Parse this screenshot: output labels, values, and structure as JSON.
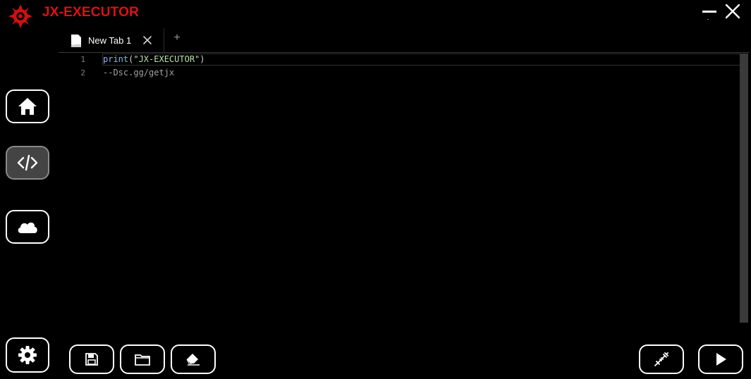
{
  "app": {
    "title": "JX-EXECUTOR",
    "brand_color": "#e01010",
    "logo_icon": "sharingan-logo-icon"
  },
  "window_controls": {
    "minimize_icon": "minimize-icon",
    "close_icon": "close-icon"
  },
  "tabs": [
    {
      "label": "New Tab 1",
      "icon": "document-icon",
      "close_icon": "close-icon"
    }
  ],
  "add_tab_label": "+",
  "editor": {
    "lines": [
      {
        "number": "1",
        "fn": "print",
        "open": "(",
        "str": "\"JX-EXECUTOR\"",
        "close": ")"
      },
      {
        "number": "2",
        "comment": "--Dsc.gg/getjx"
      }
    ]
  },
  "sidebar": {
    "items": [
      {
        "name": "home",
        "icon": "home-icon",
        "active": false
      },
      {
        "name": "editor",
        "icon": "code-icon",
        "active": true
      },
      {
        "name": "cloud",
        "icon": "cloud-icon",
        "active": false
      },
      {
        "name": "settings",
        "icon": "gear-icon",
        "active": false
      }
    ]
  },
  "toolbar": {
    "left": [
      {
        "name": "save",
        "icon": "save-icon"
      },
      {
        "name": "open",
        "icon": "folder-icon"
      },
      {
        "name": "clear",
        "icon": "eraser-icon"
      }
    ],
    "right": [
      {
        "name": "inject",
        "icon": "syringe-icon"
      },
      {
        "name": "execute",
        "icon": "play-icon"
      }
    ]
  }
}
